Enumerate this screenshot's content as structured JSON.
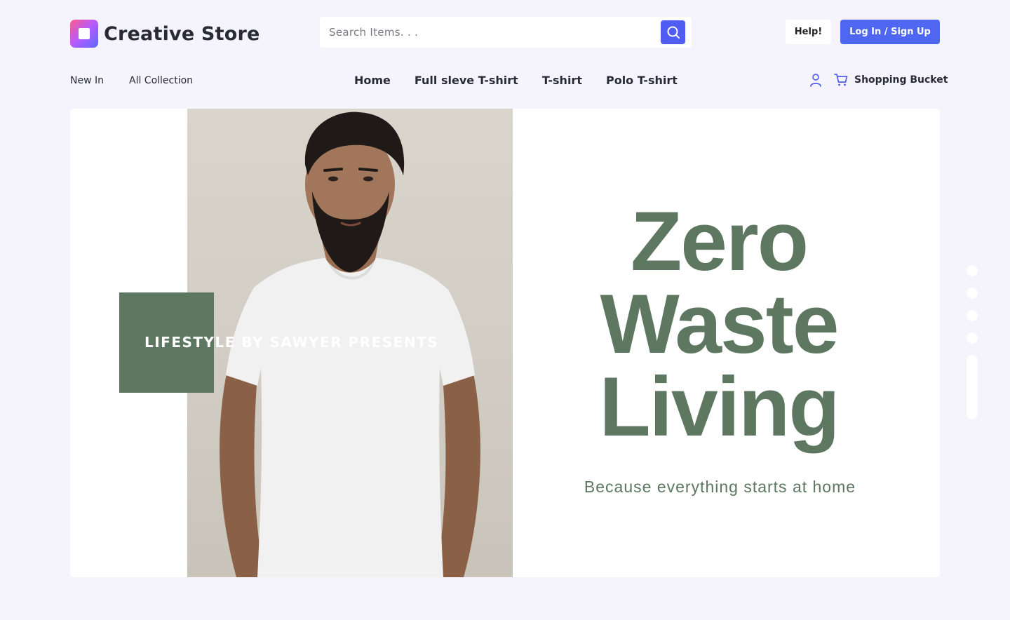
{
  "brand": {
    "name": "Creative Store",
    "logo_icon": "square-logo-icon"
  },
  "search": {
    "placeholder": "Search Items. . .",
    "value": "",
    "button_icon": "search-icon"
  },
  "header": {
    "help_label": "Help!",
    "login_label": "Log In / Sign Up"
  },
  "nav": {
    "left": [
      {
        "label": "New In"
      },
      {
        "label": "All Collection"
      }
    ],
    "center": [
      {
        "label": "Home"
      },
      {
        "label": "Full sleve T-shirt"
      },
      {
        "label": "T-shirt"
      },
      {
        "label": "Polo T-shirt"
      }
    ],
    "right": {
      "user_icon": "user-icon",
      "cart_icon": "cart-icon",
      "cart_label": "Shopping Bucket"
    }
  },
  "hero": {
    "overlay_text": "LIFESTYLE BY SAWYER PRESENTS",
    "headline": [
      "Zero",
      "Waste",
      "Living"
    ],
    "tagline": "Because everything starts at home"
  },
  "slider": {
    "dot_count": 5,
    "active_index": 4
  },
  "colors": {
    "accent": "#4f5df2",
    "hero_green": "#5d7760",
    "background": "#f5f4fd"
  }
}
